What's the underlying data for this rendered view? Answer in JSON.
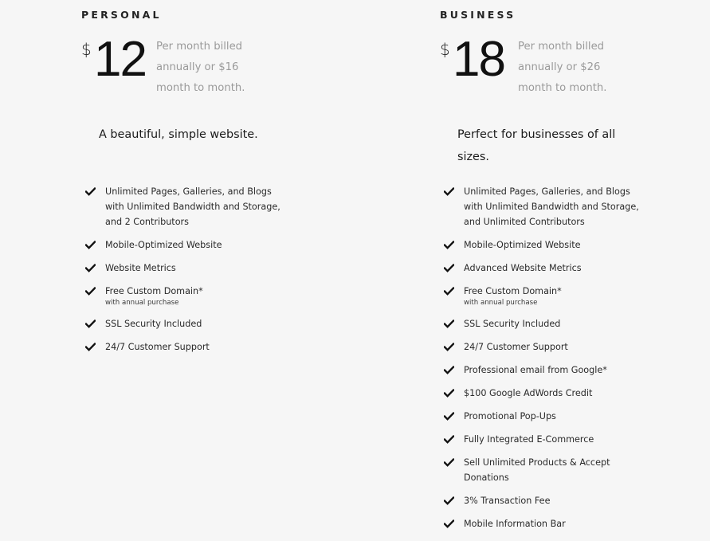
{
  "plans": [
    {
      "name": "PERSONAL",
      "currency": "$",
      "price": "12",
      "billing": "Per month billed annually or $16 month to month.",
      "tagline": "A beautiful, simple website.",
      "features": [
        {
          "text": "Unlimited Pages, Galleries, and Blogs with Unlimited Bandwidth and Storage, and 2 Contributors",
          "note": null,
          "icon": "check-icon"
        },
        {
          "text": "Mobile-Optimized Website",
          "note": null,
          "icon": "check-icon"
        },
        {
          "text": "Website Metrics",
          "note": null,
          "icon": "check-icon"
        },
        {
          "text": "Free Custom Domain*",
          "note": "with annual purchase",
          "icon": "check-icon"
        },
        {
          "text": "SSL Security Included",
          "note": null,
          "icon": "check-icon"
        },
        {
          "text": "24/7 Customer Support",
          "note": null,
          "icon": "check-icon"
        }
      ]
    },
    {
      "name": "BUSINESS",
      "currency": "$",
      "price": "18",
      "billing": "Per month billed annually or $26 month to month.",
      "tagline": "Perfect for businesses of all sizes.",
      "features": [
        {
          "text": "Unlimited Pages, Galleries, and Blogs with Unlimited Bandwidth and Storage, and Unlimited Contributors",
          "note": null,
          "icon": "check-icon"
        },
        {
          "text": "Mobile-Optimized Website",
          "note": null,
          "icon": "check-icon"
        },
        {
          "text": "Advanced Website Metrics",
          "note": null,
          "icon": "check-icon"
        },
        {
          "text": "Free Custom Domain*",
          "note": "with annual purchase",
          "icon": "check-icon"
        },
        {
          "text": "SSL Security Included",
          "note": null,
          "icon": "check-icon"
        },
        {
          "text": "24/7 Customer Support",
          "note": null,
          "icon": "check-icon"
        },
        {
          "text": "Professional email from Google*",
          "note": null,
          "icon": "check-icon"
        },
        {
          "text": "$100 Google AdWords Credit",
          "note": null,
          "icon": "check-icon"
        },
        {
          "text": "Promotional Pop-Ups",
          "note": null,
          "icon": "check-icon"
        },
        {
          "text": "Fully Integrated E-Commerce",
          "note": null,
          "icon": "check-icon"
        },
        {
          "text": "Sell Unlimited Products & Accept Donations",
          "note": null,
          "icon": "check-icon"
        },
        {
          "text": "3% Transaction Fee",
          "note": null,
          "icon": "check-icon"
        },
        {
          "text": "Mobile Information Bar",
          "note": null,
          "icon": "check-icon"
        }
      ]
    }
  ],
  "colors": {
    "background": "#f6f6f6",
    "text": "#1b1b1b",
    "muted": "#9a9a9a"
  }
}
